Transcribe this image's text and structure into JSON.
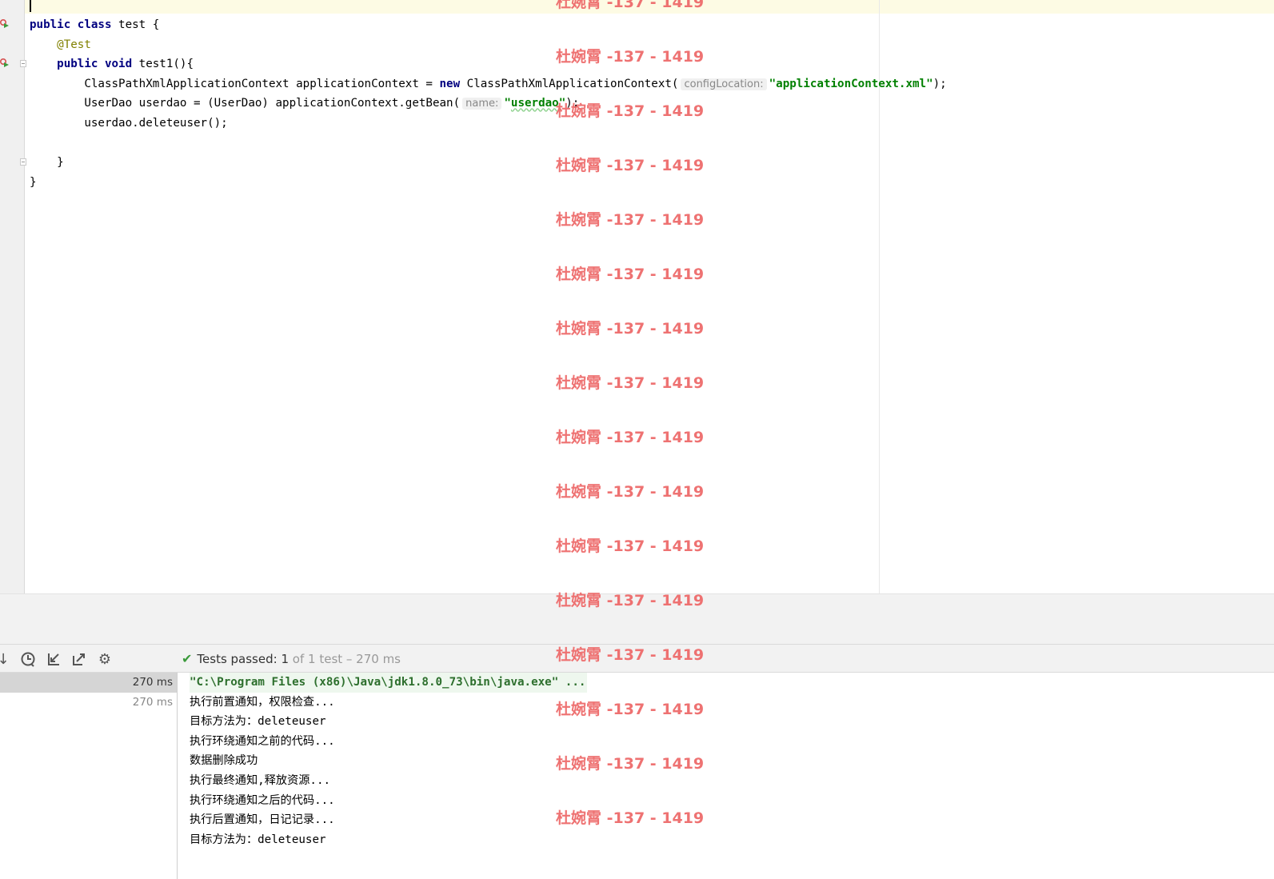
{
  "editor": {
    "lines": [
      [
        {
          "t": "public",
          "c": "kw"
        },
        {
          "t": " "
        },
        {
          "t": "class",
          "c": "kw"
        },
        {
          "t": " test {"
        }
      ],
      [
        {
          "t": "    "
        },
        {
          "t": "@Test",
          "c": "ann"
        }
      ],
      [
        {
          "t": "    "
        },
        {
          "t": "public",
          "c": "kw"
        },
        {
          "t": " "
        },
        {
          "t": "void",
          "c": "kw"
        },
        {
          "t": " test1(){"
        }
      ],
      [
        {
          "t": "        ClassPathXmlApplicationContext applicationContext = "
        },
        {
          "t": "new",
          "c": "kw"
        },
        {
          "t": " ClassPathXmlApplicationContext("
        },
        {
          "t": "configLocation:",
          "c": "hint"
        },
        {
          "t": "\"applicationContext.xml\"",
          "c": "str"
        },
        {
          "t": ");"
        }
      ],
      [
        {
          "t": "        UserDao userdao = (UserDao) applicationContext.getBean("
        },
        {
          "t": "name:",
          "c": "hint"
        },
        {
          "t": "\"",
          "c": "str"
        },
        {
          "t": "userdao",
          "c": "str wavy"
        },
        {
          "t": "\"",
          "c": "str"
        },
        {
          "t": ");"
        }
      ],
      [
        {
          "t": "        userdao.deleteuser();"
        }
      ],
      [
        {
          "t": ""
        }
      ],
      [
        {
          "t": "    }"
        }
      ],
      [
        {
          "t": "}"
        }
      ]
    ]
  },
  "run_panel": {
    "status_label": "Tests passed:",
    "status_passed": "1",
    "status_count": "of 1 test – 270 ms",
    "tree_rows": [
      {
        "time": "270 ms",
        "selected": true
      },
      {
        "time": "270 ms",
        "selected": false
      }
    ]
  },
  "console": {
    "lines": [
      "\"C:\\Program Files (x86)\\Java\\jdk1.8.0_73\\bin\\java.exe\" ...",
      "执行前置通知，权限检查...",
      "目标方法为：deleteuser",
      "执行环绕通知之前的代码...",
      "数据删除成功",
      "执行最终通知,释放资源...",
      "执行环绕通知之后的代码...",
      "执行后置通知，日记记录...",
      "目标方法为：deleteuser"
    ]
  },
  "watermark": {
    "text": "杜婉霄 -137 - 1419",
    "color": "#ee6b6b",
    "count": 16
  },
  "icons": {
    "toolbar": [
      "arrow-down-icon",
      "history-icon",
      "import-icon",
      "export-icon",
      "gear-icon"
    ]
  }
}
